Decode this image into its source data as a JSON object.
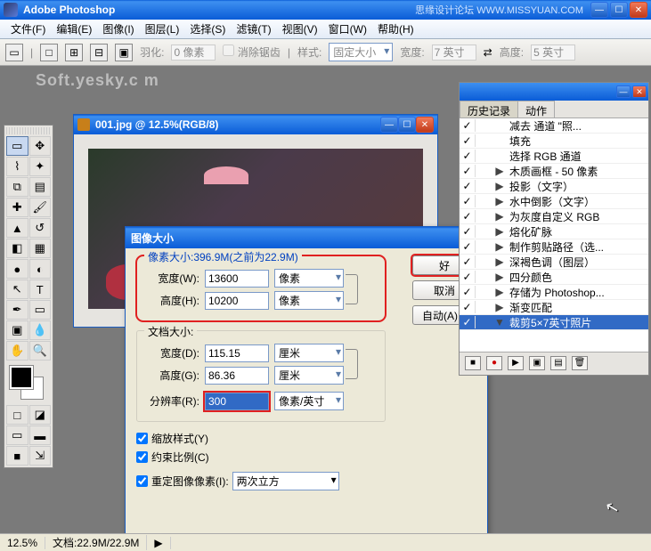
{
  "app": {
    "title": "Adobe Photoshop",
    "extra": "思缘设计论坛  WWW.MISSYUAN.COM"
  },
  "menu": [
    "文件(F)",
    "编辑(E)",
    "图像(I)",
    "图层(L)",
    "选择(S)",
    "滤镜(T)",
    "视图(V)",
    "窗口(W)",
    "帮助(H)"
  ],
  "options": {
    "feather_label": "羽化:",
    "feather_value": "0 像素",
    "antialias": "消除锯齿",
    "style_label": "样式:",
    "style_value": "固定大小",
    "width_label": "宽度:",
    "width_value": "7 英寸",
    "height_label": "高度:",
    "height_value": "5 英寸"
  },
  "watermark": "Soft.yesky.c   m",
  "doc": {
    "title": "001.jpg @ 12.5%(RGB/8)"
  },
  "dialog": {
    "title": "图像大小",
    "pixel_legend": "像素大小:396.9M(之前为22.9M)",
    "w_label": "宽度(W):",
    "w_value": "13600",
    "w_unit": "像素",
    "h_label": "高度(H):",
    "h_value": "10200",
    "h_unit": "像素",
    "doc_legend": "文档大小:",
    "dw_label": "宽度(D):",
    "dw_value": "115.15",
    "dw_unit": "厘米",
    "dh_label": "高度(G):",
    "dh_value": "86.36",
    "dh_unit": "厘米",
    "res_label": "分辨率(R):",
    "res_value": "300",
    "res_unit": "像素/英寸",
    "scale_styles": "缩放样式(Y)",
    "constrain": "约束比例(C)",
    "resample": "重定图像像素(I):",
    "resample_value": "两次立方",
    "ok": "好",
    "cancel": "取消",
    "auto": "自动(A)..."
  },
  "panel": {
    "tab1": "历史记录",
    "tab2": "动作",
    "actions": [
      "减去 通道 \"照...",
      "填充",
      "选择 RGB 通道",
      "木质画框  - 50 像素",
      "投影（文字）",
      "水中倒影（文字）",
      "为灰度自定义 RGB",
      "熔化矿脉",
      "制作剪贴路径（选...",
      "深褐色调（图层）",
      "四分颜色",
      "存储为 Photoshop...",
      "渐变匹配",
      "裁剪5×7英寸照片"
    ],
    "selected_index": 13
  },
  "status": {
    "zoom": "12.5%",
    "doc": "文档:22.9M/22.9M"
  }
}
